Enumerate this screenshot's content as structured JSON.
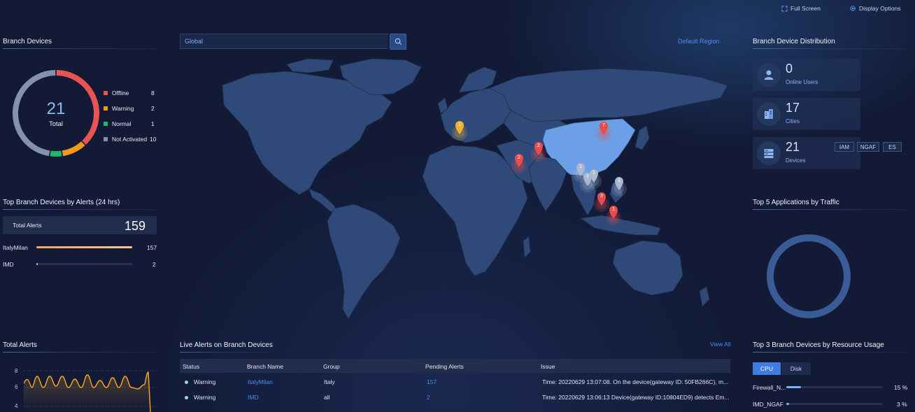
{
  "topbar": {
    "fullscreen_label": "Full Screen",
    "display_options_label": "Display Options"
  },
  "branch_devices": {
    "title": "Branch Devices",
    "total_value": "21",
    "total_label": "Total",
    "legend": [
      {
        "label": "Offline",
        "value": "8",
        "color": "#e85454"
      },
      {
        "label": "Warning",
        "value": "2",
        "color": "#f29a1a"
      },
      {
        "label": "Normal",
        "value": "1",
        "color": "#1fb66e"
      },
      {
        "label": "Not Activated",
        "value": "10",
        "color": "#8592ab"
      }
    ]
  },
  "top_alerts": {
    "title": "Top Branch Devices by Alerts (24 hrs)",
    "total_label": "Total Alerts",
    "total_value": "159",
    "rows": [
      {
        "name": "ItalyMilan",
        "value": "157",
        "fraction": 0.99
      },
      {
        "name": "IMD",
        "value": "2",
        "fraction": 0.013
      }
    ]
  },
  "total_alerts": {
    "title": "Total Alerts",
    "yticks": [
      "8",
      "6",
      "4"
    ]
  },
  "map": {
    "search_value": "Global",
    "region_label": "Default Region",
    "markers": [
      {
        "label": "1",
        "color": "#f0b030",
        "kind": "yellow"
      },
      {
        "label": "2",
        "color": "#e84c4c",
        "kind": "red"
      },
      {
        "label": "2",
        "color": "#e84c4c",
        "kind": "red"
      },
      {
        "label": "7",
        "color": "#e84c4c",
        "kind": "red"
      },
      {
        "label": "1",
        "color": "#aab8d0",
        "kind": "grey"
      },
      {
        "label": "1",
        "color": "#aab8d0",
        "kind": "grey"
      },
      {
        "label": "1",
        "color": "#aab8d0",
        "kind": "grey"
      },
      {
        "label": "1",
        "color": "#aab8d0",
        "kind": "grey"
      },
      {
        "label": "3",
        "color": "#e84c4c",
        "kind": "red"
      },
      {
        "label": "1",
        "color": "#e84c4c",
        "kind": "red"
      }
    ]
  },
  "live_alerts": {
    "title": "Live Alerts on Branch Devices",
    "view_all_label": "View All",
    "columns": [
      "Status",
      "Branch Name",
      "Group",
      "Pending Alerts",
      "Issue"
    ],
    "rows": [
      {
        "status": "Warning",
        "branch": "ItalyMilan",
        "group": "Italy",
        "pending": "157",
        "issue": "Time: 20220629 13:07:08. On the device(gateway ID: 50FB266C), m..."
      },
      {
        "status": "Warning",
        "branch": "IMD",
        "group": "all",
        "pending": "2",
        "issue": "Time: 20220629 13:06:13 Device(gateway ID:10804ED9) detects Em..."
      }
    ]
  },
  "distribution": {
    "title": "Branch Device Distribution",
    "cards": [
      {
        "value": "0",
        "label": "Online Users",
        "icon": "user-icon"
      },
      {
        "value": "17",
        "label": "Cities",
        "icon": "building-icon"
      },
      {
        "value": "21",
        "label": "Devices",
        "icon": "server-icon"
      }
    ],
    "tags": [
      "IAM",
      "NGAF",
      "ES"
    ]
  },
  "top_apps": {
    "title": "Top 5 Applications by Traffic"
  },
  "resource_usage": {
    "title": "Top 3 Branch Devices by Resource Usage",
    "tabs": [
      "CPU",
      "Disk"
    ],
    "rows": [
      {
        "name": "Firewall_N...",
        "value": "15 %",
        "fraction": 0.15
      },
      {
        "name": "IMD_NGAF",
        "value": "3 %",
        "fraction": 0.03
      }
    ]
  },
  "colors": {
    "accent": "#4c8ef5",
    "background": "#121a36",
    "land": "#2f4a78",
    "land_highlight": "#6ca0e6"
  }
}
